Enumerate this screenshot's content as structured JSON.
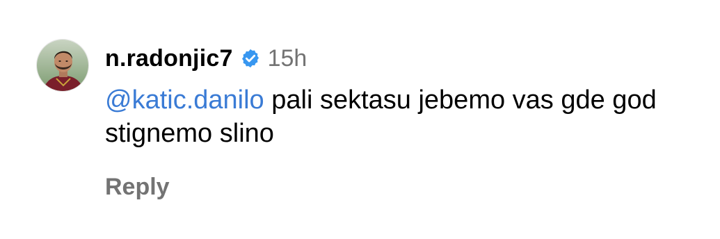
{
  "comment": {
    "username": "n.radonjic7",
    "verified_icon": "verified-badge-icon",
    "time": "15h",
    "mention": "@katic.danilo",
    "text": " pali sektasu jebemo vas gde god stignemo slino",
    "reply_label": "Reply"
  },
  "colors": {
    "mention": "#3a7bd5",
    "verified": "#3897f0",
    "muted": "#737373"
  }
}
